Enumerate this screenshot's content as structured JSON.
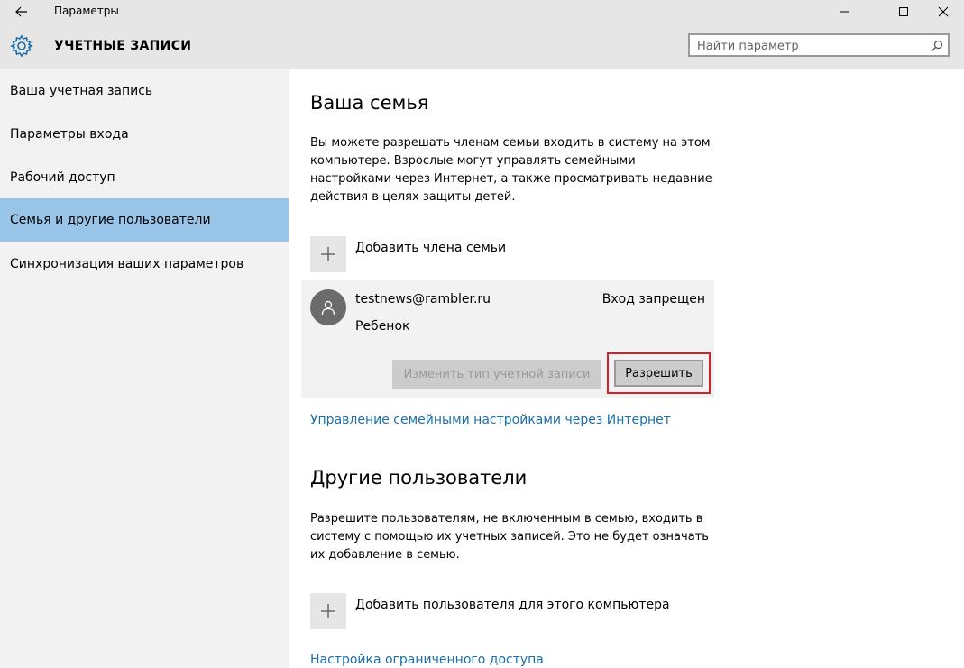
{
  "window": {
    "title": "Параметры"
  },
  "header": {
    "title": "УЧЕТНЫЕ ЗАПИСИ",
    "search_placeholder": "Найти параметр"
  },
  "sidebar": {
    "items": [
      {
        "label": "Ваша учетная запись"
      },
      {
        "label": "Параметры входа"
      },
      {
        "label": "Рабочий доступ"
      },
      {
        "label": "Семья и другие пользователи"
      },
      {
        "label": "Синхронизация ваших параметров"
      }
    ],
    "active_index": 3
  },
  "family": {
    "heading": "Ваша семья",
    "description": "Вы можете разрешать членам семьи входить в систему на этом компьютере. Взрослые могут управлять семейными настройками через Интернет, а также просматривать недавние действия в целях защиты детей.",
    "add_label": "Добавить члена семьи",
    "member": {
      "email": "testnews@rambler.ru",
      "role": "Ребенок",
      "status": "Вход запрещен",
      "change_type_label": "Изменить тип учетной записи",
      "allow_label": "Разрешить"
    },
    "manage_link": "Управление семейными настройками через Интернет"
  },
  "others": {
    "heading": "Другие пользователи",
    "description": "Разрешите пользователям, не включенным в семью, входить в систему с помощью их учетных записей. Это не будет означать их добавление в семью.",
    "add_label": "Добавить пользователя для этого компьютера",
    "restricted_link": "Настройка ограниченного доступа"
  },
  "colors": {
    "accent": "#99c5e8",
    "link": "#1a6fa8",
    "highlight_border": "#d2232a"
  }
}
